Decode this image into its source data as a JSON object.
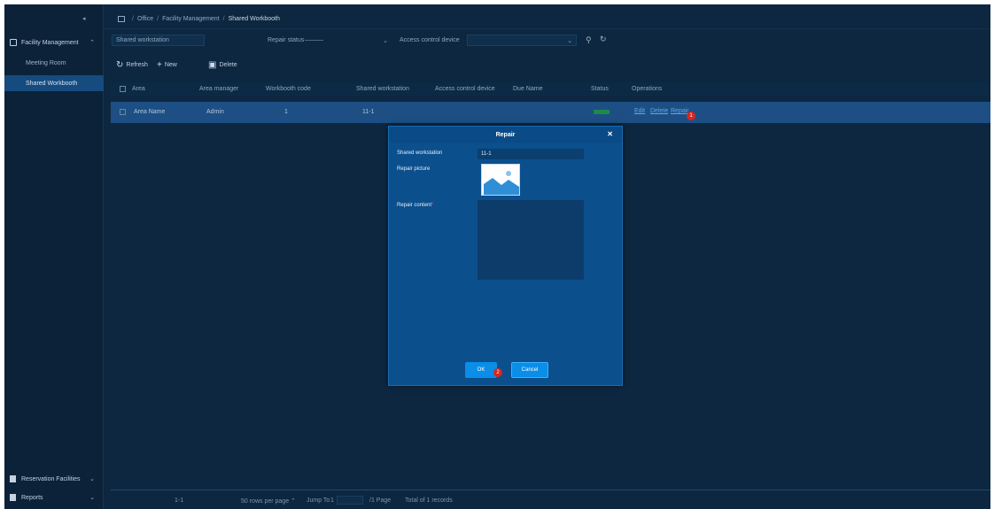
{
  "breadcrumb": {
    "items": [
      "Office",
      "Facility Management",
      "Shared Workbooth"
    ]
  },
  "sidebar": {
    "groups": [
      {
        "label": "Facility Management",
        "expanded": true
      }
    ],
    "items": [
      {
        "label": "Meeting Room",
        "active": false
      },
      {
        "label": "Shared Workbooth",
        "active": true
      }
    ],
    "bottom": [
      {
        "label": "Reservation Facilities"
      },
      {
        "label": "Reports"
      }
    ]
  },
  "filters": {
    "workstation_placeholder": "Shared workstation",
    "repair_status_label": "Repair status",
    "repair_status_value": "———",
    "access_control_label": "Access control device"
  },
  "toolbar": {
    "refresh": "Refresh",
    "new": "New",
    "delete": "Delete"
  },
  "table": {
    "headers": [
      "Area",
      "Area manager",
      "Workbooth code",
      "Shared workstation",
      "Access control device",
      "Due Name",
      "Status",
      "Operations"
    ],
    "rows": [
      {
        "area": "Area Name",
        "manager": "Admin",
        "code": "1",
        "workstation": "11-1",
        "status": "Normal",
        "ops": [
          "Edit",
          "Delete",
          "Repair"
        ]
      }
    ]
  },
  "markers": [
    "1",
    "2"
  ],
  "pagination": {
    "range": "1-1",
    "per_page": "50 rows per page",
    "jump_label": "Jump To",
    "jump_value": "1",
    "pages": "/1 Page",
    "total": "Total of 1 records"
  },
  "modal": {
    "title": "Repair",
    "workstation_label": "Shared workstation",
    "workstation_value": "11-1",
    "picture_label": "Repair picture",
    "content_label": "Repair content",
    "content_required": "*",
    "ok": "OK",
    "cancel": "Cancel"
  },
  "colors": {
    "background": "#0d2741",
    "sidebar": "#0b2238",
    "active_row": "#1d4f84",
    "modal": "#0b4f8d",
    "primary_button": "#0a8ee8",
    "marker": "#d8261f",
    "status_ok": "#1e8a46"
  },
  "icons": [
    "home-icon",
    "facility-icon",
    "refresh-icon",
    "plus-icon",
    "trash-icon",
    "search-icon",
    "reset-icon",
    "close-icon",
    "image-icon",
    "document-icon",
    "chevron-down-icon",
    "collapse-icon"
  ]
}
